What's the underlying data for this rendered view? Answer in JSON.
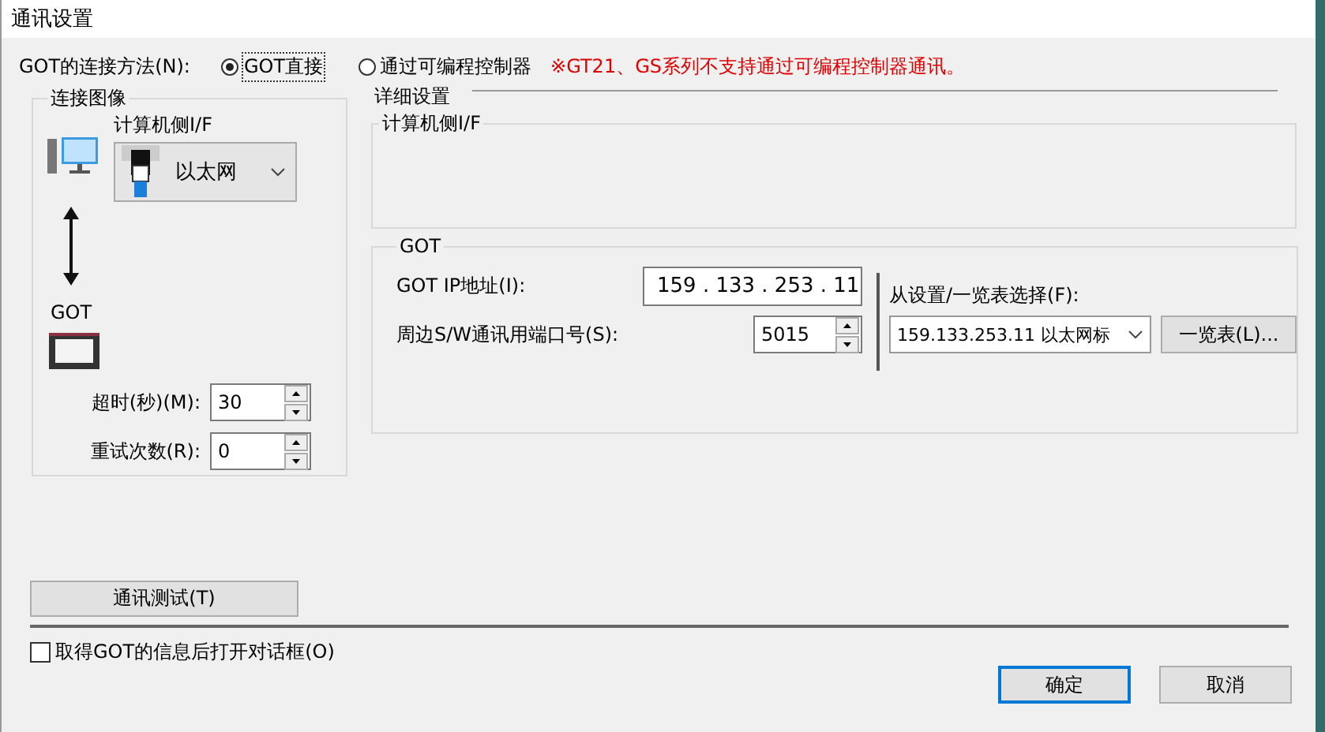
{
  "window": {
    "title": "通讯设置"
  },
  "connection_method": {
    "label": "GOT的连接方法(N):",
    "options": [
      {
        "label": "GOT直接",
        "selected": true
      },
      {
        "label": "通过可编程控制器",
        "selected": false
      }
    ],
    "note": "※GT21、GS系列不支持通过可编程控制器通讯。"
  },
  "connection_image": {
    "title": "连接图像",
    "computer_if_label": "计算机侧I/F",
    "interface": "以太网",
    "got_label": "GOT",
    "timeout": {
      "label": "超时(秒)(M):",
      "value": "30"
    },
    "retries": {
      "label": "重试次数(R):",
      "value": "0"
    }
  },
  "detail": {
    "title": "详细设置",
    "computer_if": {
      "title": "计算机侧I/F"
    },
    "got": {
      "title": "GOT",
      "ip": {
        "label": "GOT IP地址(I):",
        "value": "159 . 133 . 253 . 11"
      },
      "port": {
        "label": "周边S/W通讯用端口号(S):",
        "value": "5015"
      },
      "select_label": "从设置/一览表选择(F):",
      "select_value": "159.133.253.11 以太网标",
      "list_button": "一览表(L)..."
    }
  },
  "test_button": "通讯测试(T)",
  "open_dialog": {
    "label": "取得GOT的信息后打开对话框(O)",
    "checked": false
  },
  "buttons": [
    {
      "label": "确定",
      "default": true
    },
    {
      "label": "取消",
      "default": false
    }
  ]
}
